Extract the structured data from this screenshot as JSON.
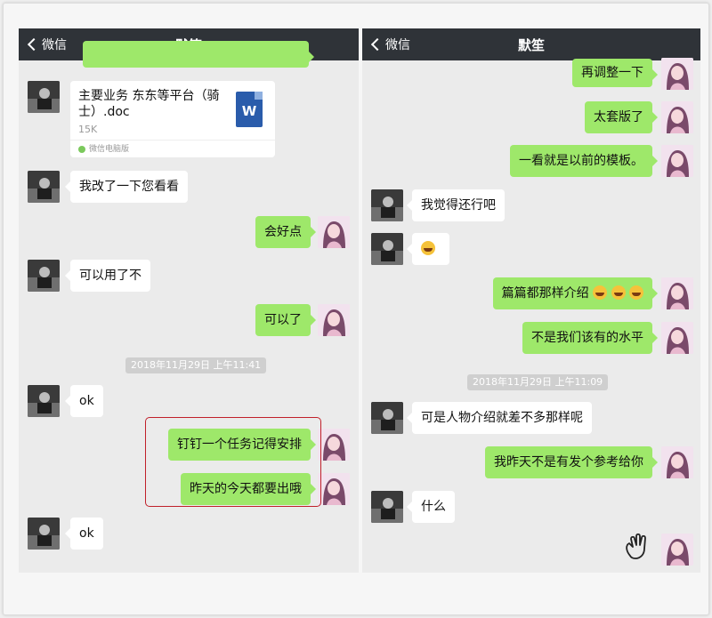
{
  "header": {
    "back_label": "微信",
    "title": "默笙"
  },
  "panel1": {
    "file": {
      "name": "主要业务 东东等平台（骑士）.doc",
      "size": "15K",
      "source": "微信电脑版",
      "badge": "W"
    },
    "messages": [
      {
        "side": "left",
        "text": "我改了一下您看看"
      },
      {
        "side": "right",
        "text": "会好点"
      },
      {
        "side": "left",
        "text": "可以用了不"
      },
      {
        "side": "right",
        "text": "可以了"
      },
      {
        "side": "left",
        "text": "ok"
      },
      {
        "side": "right",
        "text": "钉钉一个任务记得安排"
      },
      {
        "side": "right",
        "text": "昨天的今天都要出哦"
      },
      {
        "side": "left",
        "text": "ok"
      }
    ],
    "timestamp": "2018年11月29日 上午11:41"
  },
  "panel2": {
    "messages": [
      {
        "side": "right",
        "text": "再调整一下"
      },
      {
        "side": "right",
        "text": "太套版了"
      },
      {
        "side": "right",
        "text": "一看就是以前的模板。"
      },
      {
        "side": "left",
        "text": "我觉得还行吧"
      },
      {
        "side": "left",
        "text": ""
      },
      {
        "side": "right",
        "text": "篇篇都那样介绍"
      },
      {
        "side": "right",
        "text": "不是我们该有的水平"
      },
      {
        "side": "left",
        "text": "可是人物介绍就差不多那样呢"
      },
      {
        "side": "right",
        "text": "我昨天不是有发个参考给你"
      },
      {
        "side": "left",
        "text": "什么"
      }
    ],
    "timestamp": "2018年11月29日 上午11:09"
  },
  "colors": {
    "header": "#2f3338",
    "sent_bubble": "#9ee86a",
    "received_bubble": "#ffffff",
    "highlight_box": "#c0202a"
  },
  "icons": [
    "back-chevron-icon",
    "word-file-icon",
    "laughing-emoji-icon",
    "wave-hand-icon"
  ]
}
